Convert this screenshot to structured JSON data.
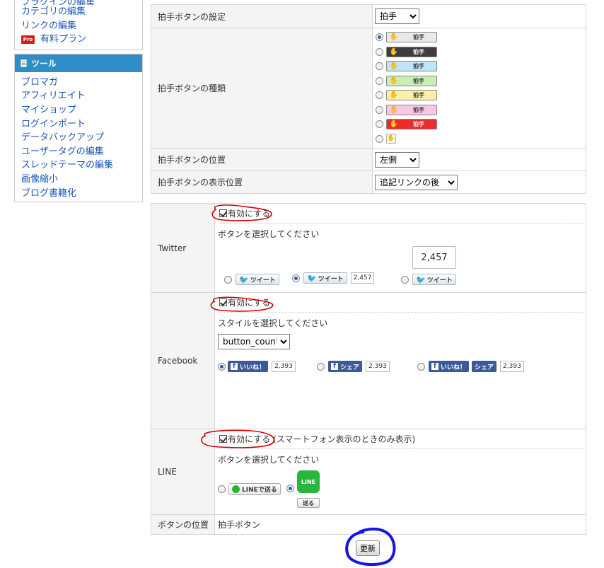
{
  "sidebar": {
    "top_items": [
      {
        "label": "プラグインの編集"
      },
      {
        "label": "カテゴリの編集"
      },
      {
        "label": "リンクの編集"
      }
    ],
    "pro": {
      "badge": "Pro",
      "label": "有料プラン"
    },
    "tools": {
      "header": "ツール",
      "items": [
        {
          "label": "ブロマガ"
        },
        {
          "label": "アフィリエイト"
        },
        {
          "label": "マイショップ"
        },
        {
          "label": "ログインポート"
        },
        {
          "label": "データバックアップ"
        },
        {
          "label": "ユーザータグの編集"
        },
        {
          "label": "スレッドテーマの編集"
        },
        {
          "label": "画像縮小"
        },
        {
          "label": "ブログ書籍化"
        }
      ]
    }
  },
  "clap": {
    "setting_label": "拍手ボタンの設定",
    "setting_value": "拍手",
    "type_label": "拍手ボタンの種類",
    "button_text": "拍手",
    "styles": [
      {
        "bg": "#e9e9e9",
        "fg": "#333333",
        "selected": true
      },
      {
        "bg": "#3d3d3d",
        "fg": "#ffffff",
        "selected": false
      },
      {
        "bg": "#bfe6f8",
        "fg": "#333333",
        "selected": false
      },
      {
        "bg": "#c9f0b4",
        "fg": "#333333",
        "selected": false
      },
      {
        "bg": "#fbf0a6",
        "fg": "#333333",
        "selected": false
      },
      {
        "bg": "#f8c6e6",
        "fg": "#333333",
        "selected": false
      },
      {
        "bg": "#ee2a2a",
        "fg": "#ffffff",
        "selected": false
      }
    ],
    "position_label": "拍手ボタンの位置",
    "position_value": "左側",
    "display_label": "拍手ボタンの表示位置",
    "display_value": "追記リンクの後"
  },
  "social": {
    "enable_label": "有効にする",
    "twitter": {
      "label": "Twitter",
      "prompt": "ボタンを選択してください",
      "button_text": "ツイート",
      "count": "2,457"
    },
    "facebook": {
      "label": "Facebook",
      "prompt": "スタイルを選択してください",
      "select_value": "button_count",
      "like_text": "いいね！",
      "share_text": "シェア",
      "count": "2,393"
    },
    "line": {
      "label": "LINE",
      "enable_note": "(スマートフォン表示のときのみ表示)",
      "prompt": "ボタンを選択してください",
      "button_text": "LINEで送る",
      "icon_text": "LINE",
      "send_text": "送る"
    },
    "position": {
      "label": "ボタンの位置",
      "value": "拍手ボタン"
    }
  },
  "update_button": "更新",
  "annotation_colors": {
    "red": "#d40000",
    "blue": "#1616e0"
  }
}
